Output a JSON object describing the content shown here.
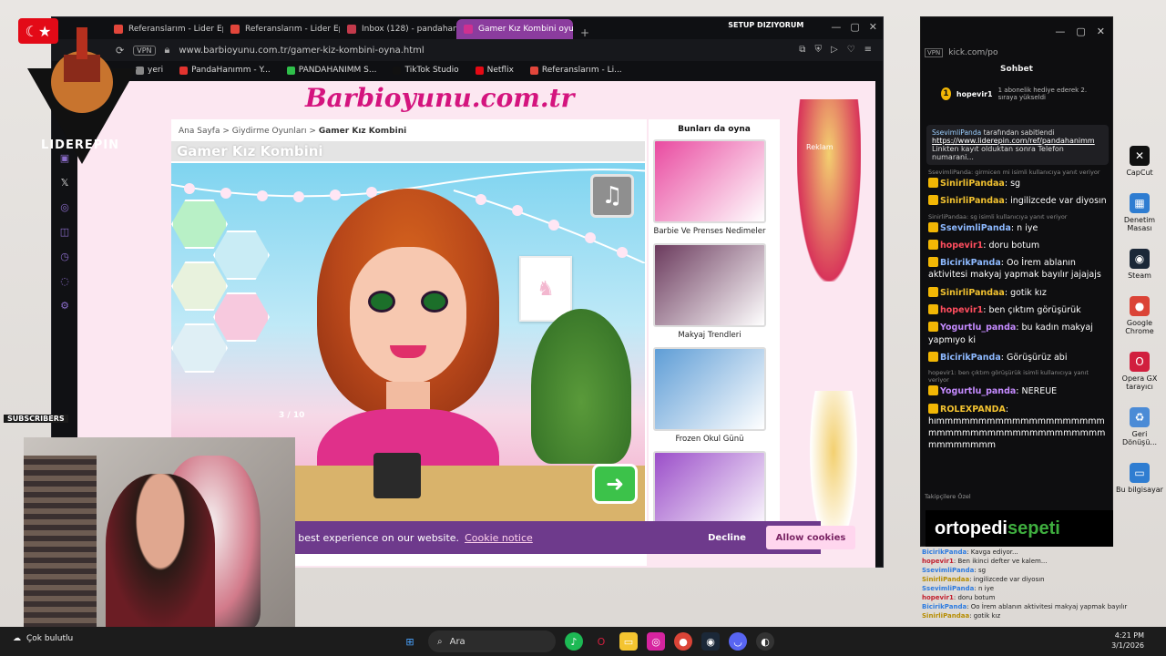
{
  "browser": {
    "tabs": [
      {
        "label": "Referanslarım - Lider Epin",
        "color": "#e2463b",
        "active": false
      },
      {
        "label": "Referanslarım - Lider Epin",
        "color": "#e2463b",
        "active": false
      },
      {
        "label": "Inbox (128) - pandahanim",
        "color": "#c33a4b",
        "active": false
      },
      {
        "label": "Gamer Kız Kombini oyunu",
        "color": "#d03090",
        "active": true
      }
    ],
    "new_tab": "+",
    "vpn": "VPN",
    "url": "www.barbioyunu.com.tr/gamer-kiz-kombini-oyna.html",
    "setup_label": "SETUP DIZIYORUM",
    "bookmarks": [
      {
        "label": "yeri",
        "color": "#888"
      },
      {
        "label": "PandaHanımm - Y...",
        "color": "#e3342f"
      },
      {
        "label": "PANDAHANIMM S...",
        "color": "#2fbf4a"
      },
      {
        "label": "TikTok Studio",
        "color": "#111111"
      },
      {
        "label": "Netflix",
        "color": "#e50914"
      },
      {
        "label": "Referanslarım - Li...",
        "color": "#e2463b"
      }
    ]
  },
  "site": {
    "brand": "Barbioyunu.com.tr",
    "breadcrumb": {
      "home": "Ana Sayfa",
      "sep1": ">",
      "category": "Giydirme Oyunları",
      "sep2": ">",
      "current": "Gamer Kız Kombini"
    },
    "game_title": "Gamer Kız Kombini",
    "music_icon": "♫",
    "counter": "3 / 10",
    "next_icon": "➜",
    "reklam": "Reklam",
    "suggestions_header": "Bunları da oyna",
    "suggestions": [
      {
        "label": "Barbie Ve Prenses Nedimeler",
        "color": "#e94aa0"
      },
      {
        "label": "Makyaj Trendleri",
        "color": "#6b3a5d"
      },
      {
        "label": "Frozen Okul Günü",
        "color": "#5e9dd6"
      },
      {
        "label": "",
        "color": "#9b4ec9"
      }
    ]
  },
  "cookie": {
    "text": "e best experience on our website.",
    "link": "Cookie notice",
    "decline": "Decline",
    "allow": "Allow cookies"
  },
  "overlay": {
    "logo": "LIDEREPIN",
    "flag": "☾★",
    "subscribers_label": "SUBSCRIBERS"
  },
  "chat": {
    "url": "kick.com/po",
    "header": "Sohbet",
    "gift": {
      "count": "1",
      "user": "hopevir1",
      "text": "1 abonelik hediye ederek 2. sıraya yükseldi"
    },
    "pinned": {
      "who": "SsevimliPanda",
      "who_suffix": "tarafından sabitlendi",
      "link": "https://www.liderepin.com/ref/pandahanimm",
      "body": "Linkten kayıt olduktan sonra Telefon numarani..."
    },
    "messages": [
      {
        "reply": "SsevimliPanda: girmicen mi isimli kullanıcıya yanıt veriyor",
        "user": "SinirliPandaa",
        "color": "#f2c230",
        "text": "sg"
      },
      {
        "reply": "",
        "user": "SinirliPandaa",
        "color": "#f2c230",
        "text": "ingilizcede var diyosın"
      },
      {
        "reply": "SinirliPandaa: sg isimli kullanıcıya yanıt veriyor",
        "user": "SsevimliPanda",
        "color": "#8db9ff",
        "text": "n iye"
      },
      {
        "reply": "",
        "user": "hopevir1",
        "color": "#ff4d5e",
        "text": "doru botum"
      },
      {
        "reply": "",
        "user": "BicirikPanda",
        "color": "#8db9ff",
        "text": "Oo İrem ablanın aktivitesi makyaj yapmak bayılır jajajajs"
      },
      {
        "reply": "",
        "user": "SinirliPandaa",
        "color": "#f2c230",
        "text": "gotik kız"
      },
      {
        "reply": "",
        "user": "hopevir1",
        "color": "#ff4d5e",
        "text": "ben çıktım görüşürük"
      },
      {
        "reply": "",
        "user": "Yogurtlu_panda",
        "color": "#c58bff",
        "text": "bu kadın makyaj yapmıyo ki"
      },
      {
        "reply": "",
        "user": "BicirikPanda",
        "color": "#8db9ff",
        "text": "Görüşürüz abi"
      },
      {
        "reply": "hopevir1: ben çıktım görüşürük isimli kullanıcıya yanıt veriyor",
        "user": "Yogurtlu_panda",
        "color": "#c58bff",
        "text": "NEREUE"
      },
      {
        "reply": "",
        "user": "ROLEXPANDA",
        "color": "#f2c230",
        "text": "hımmmmmmmmmmmmmmmmmmmmmmmmmmmmmmmmmmmmmmmmmmmmmmmmm"
      }
    ],
    "footer": "Takipçilere Özel",
    "ad_text_1": "ortopedi",
    "ad_text_2": "sepeti"
  },
  "overlay_chat": [
    {
      "user": "BicirikPanda",
      "color": "#2d7be0",
      "text": "Kavga ediyor..."
    },
    {
      "user": "hopevir1",
      "color": "#c2202f",
      "text": "Ben ikinci defter ve kalem..."
    },
    {
      "user": "SsevimliPanda",
      "color": "#2d7be0",
      "text": "sg"
    },
    {
      "user": "SinirliPandaa",
      "color": "#b68c00",
      "text": "ingilizcede var diyosın"
    },
    {
      "user": "SsevimliPanda",
      "color": "#2d7be0",
      "text": "n iye"
    },
    {
      "user": "hopevir1",
      "color": "#c2202f",
      "text": "doru botum"
    },
    {
      "user": "BicirikPanda",
      "color": "#2d7be0",
      "text": "Oo İrem ablanın aktivitesi makyaj yapmak bayılır"
    },
    {
      "user": "SinirliPandaa",
      "color": "#b68c00",
      "text": "gotik kız"
    }
  ],
  "desktop_icons": [
    {
      "label": "CapCut",
      "color": "#111111",
      "glyph": "✕"
    },
    {
      "label": "Denetim Masası",
      "color": "#2f7dd1",
      "glyph": "▦"
    },
    {
      "label": "Steam",
      "color": "#1b2838",
      "glyph": "◉"
    },
    {
      "label": "Google Chrome",
      "color": "#db4437",
      "glyph": "●"
    },
    {
      "label": "Opera GX tarayıcı",
      "color": "#d11f3e",
      "glyph": "O"
    },
    {
      "label": "Geri Dönüşü...",
      "color": "#4b8bd6",
      "glyph": "♻"
    },
    {
      "label": "Bu bilgisayar",
      "color": "#2f7dd1",
      "glyph": "▭"
    }
  ],
  "taskbar": {
    "weather": "Çok bulutlu",
    "search_placeholder": "Ara",
    "time": "4:21 PM",
    "date": "3/1/2026"
  }
}
